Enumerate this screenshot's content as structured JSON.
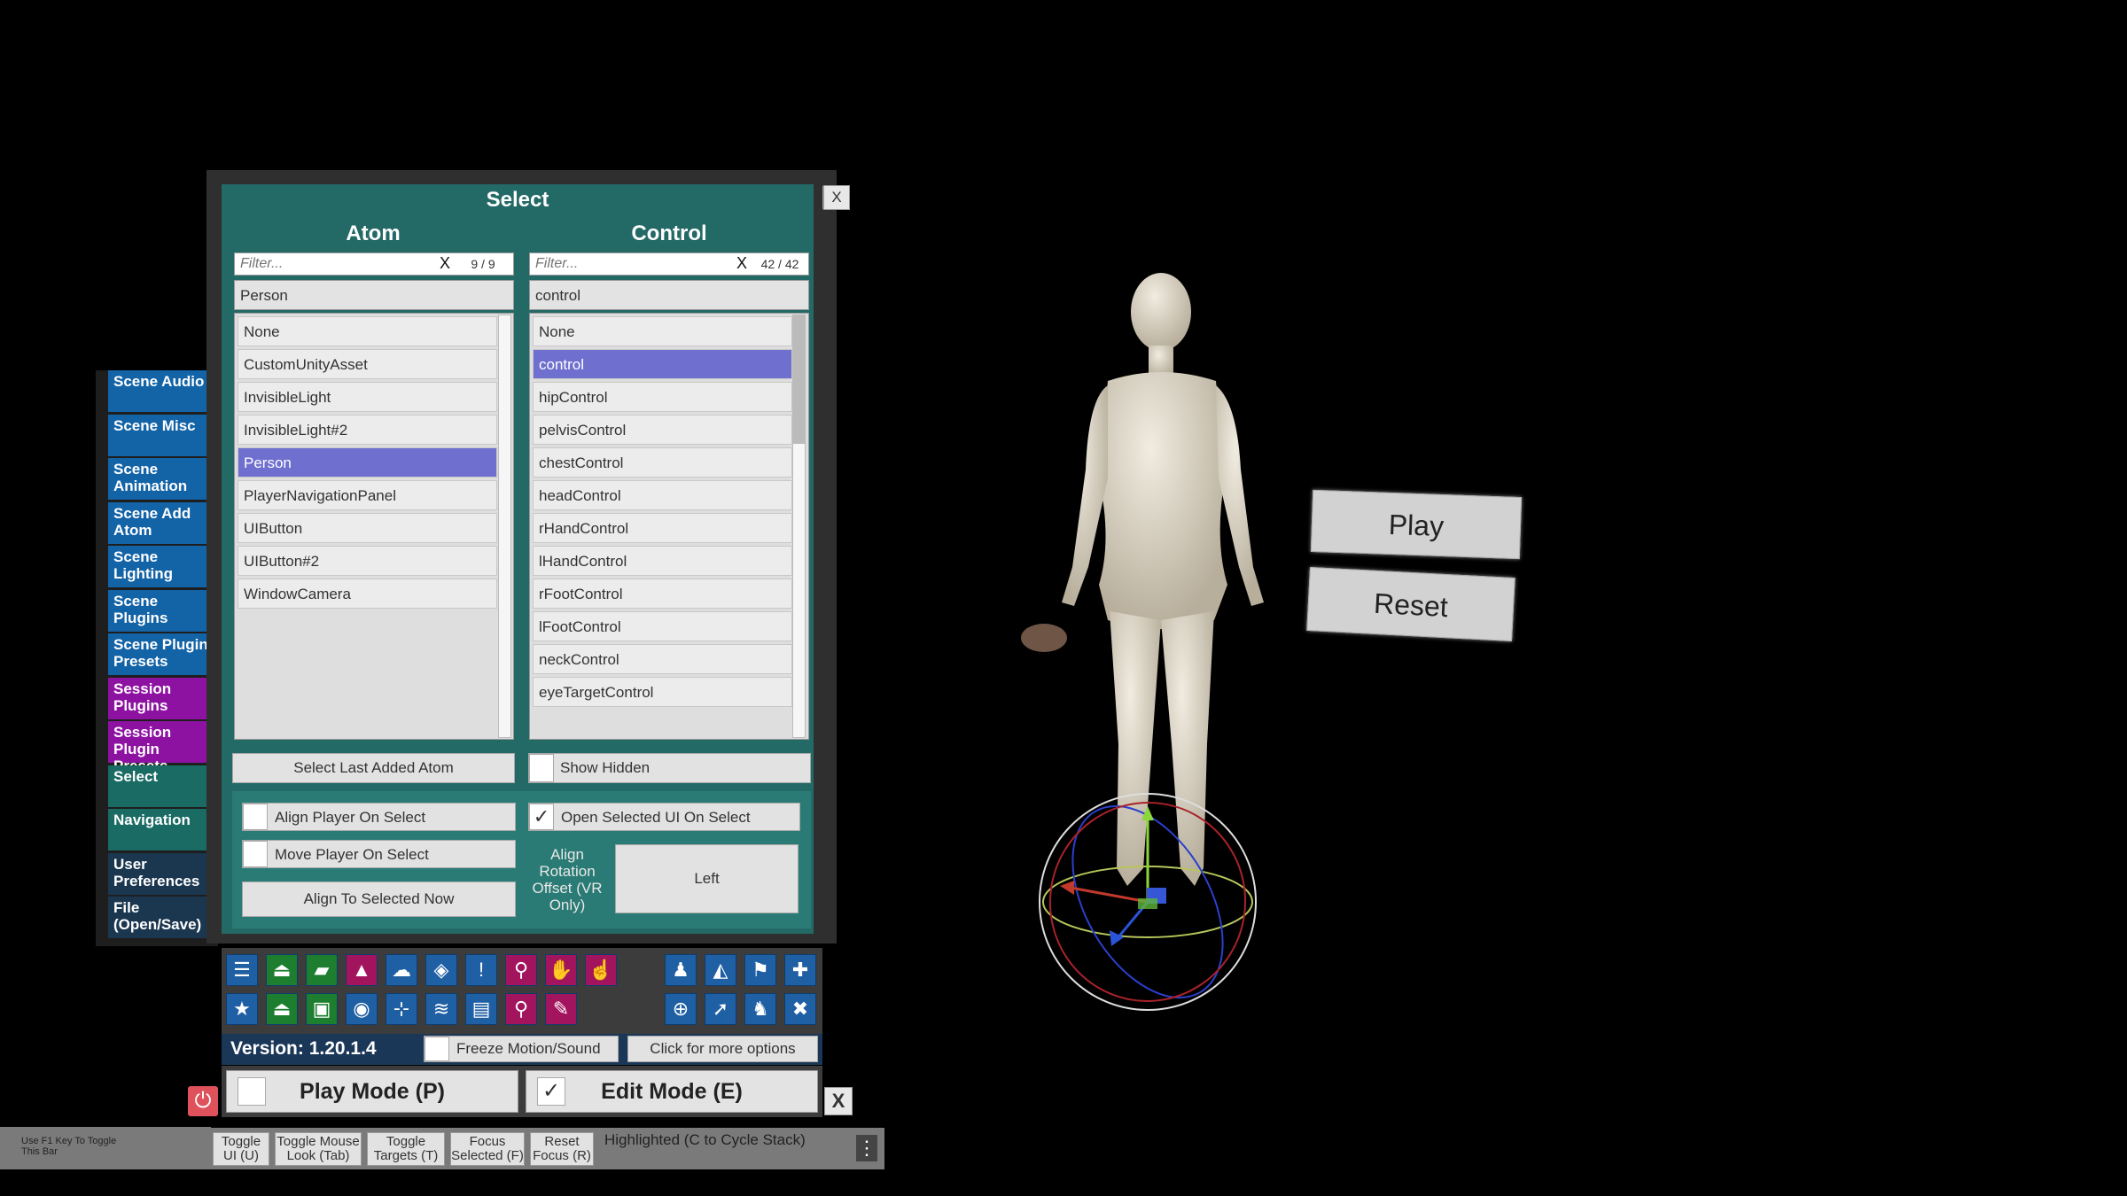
{
  "panel": {
    "title": "Select",
    "close_label": "X",
    "atom": {
      "heading": "Atom",
      "filter_placeholder": "Filter...",
      "filter_clear": "X",
      "filter_count": "9 / 9",
      "selected": "Person",
      "items": [
        "None",
        "CustomUnityAsset",
        "InvisibleLight",
        "InvisibleLight#2",
        "Person",
        "PlayerNavigationPanel",
        "UIButton",
        "UIButton#2",
        "WindowCamera"
      ],
      "selected_index": 4
    },
    "control": {
      "heading": "Control",
      "filter_placeholder": "Filter...",
      "filter_clear": "X",
      "filter_count": "42 / 42",
      "selected": "control",
      "items": [
        "None",
        "control",
        "hipControl",
        "pelvisControl",
        "chestControl",
        "headControl",
        "rHandControl",
        "lHandControl",
        "rFootControl",
        "lFootControl",
        "neckControl",
        "eyeTargetControl"
      ],
      "selected_index": 1
    },
    "select_last_added": "Select Last Added Atom",
    "show_hidden": "Show Hidden",
    "align_player_on_select": "Align Player On Select",
    "open_selected_ui": "Open Selected UI On Select",
    "move_player_on_select": "Move Player On Select",
    "align_to_selected_now": "Align To Selected Now",
    "align_rotation_offset": "Align Rotation Offset (VR Only)",
    "align_rotation_value": "Left"
  },
  "tabs": [
    {
      "label": "Scene Audio",
      "color": "#1363a7"
    },
    {
      "label": "Scene Misc",
      "color": "#1363a7"
    },
    {
      "label": "Scene Animation",
      "color": "#1363a7"
    },
    {
      "label": "Scene Add Atom",
      "color": "#1363a7"
    },
    {
      "label": "Scene Lighting",
      "color": "#1363a7"
    },
    {
      "label": "Scene Plugins",
      "color": "#1363a7"
    },
    {
      "label": "Scene Plugin Presets",
      "color": "#1363a7"
    },
    {
      "label": "Session Plugins",
      "color": "#8e12a2"
    },
    {
      "label": "Session Plugin Presets",
      "color": "#8e12a2"
    },
    {
      "label": "Select",
      "color": "#196b63"
    },
    {
      "label": "Navigation",
      "color": "#196b63"
    },
    {
      "label": "User Preferences",
      "color": "#1b3750"
    },
    {
      "label": "File (Open/Save)",
      "color": "#1b3750"
    }
  ],
  "toolbar": {
    "row1_left": [
      "menu-icon",
      "scene-open-icon",
      "folder-icon",
      "delete-scene-icon",
      "cloud-icon",
      "package-icon",
      "alert-icon",
      "person-add-icon",
      "hand-icon",
      "touch-icon"
    ],
    "row1_left_glyphs": [
      "☰",
      "⏏",
      "▰",
      "▲",
      "☁",
      "◈",
      "!",
      "⚲",
      "✋",
      "☝"
    ],
    "row2_left": [
      "star-icon",
      "scene-load-icon",
      "screenshot-folder-icon",
      "camera-icon",
      "graph-icon",
      "layers-icon",
      "document-icon",
      "person-remove-icon",
      "wrench-icon"
    ],
    "row2_left_glyphs": [
      "★",
      "⏏",
      "▣",
      "◉",
      "⊹",
      "≋",
      "▤",
      "⚲",
      "✎"
    ],
    "row1_right": [
      "person-icon",
      "unity-icon",
      "flag-icon",
      "plus-icon"
    ],
    "row1_right_glyphs": [
      "♟",
      "◭",
      "⚑",
      "✚"
    ],
    "row2_right": [
      "target-icon",
      "pointer-icon",
      "people-icon",
      "tools-icon"
    ],
    "row2_right_glyphs": [
      "⊕",
      "➚",
      "♞",
      "✖"
    ]
  },
  "version_text": "Version: 1.20.1.4",
  "freeze_label": "Freeze Motion/Sound",
  "more_options_label": "Click for more options",
  "play_mode_label": "Play Mode (P)",
  "edit_mode_label": "Edit Mode (E)",
  "close_x": "X",
  "bottom_bar": {
    "hint": "Use F1 Key To Toggle This Bar",
    "buttons": [
      "Toggle UI (U)",
      "Toggle Mouse Look (Tab)",
      "Toggle Targets (T)",
      "Focus Selected (F)",
      "Reset Focus (R)"
    ],
    "highlighted": "Highlighted (C to Cycle Stack)"
  },
  "scene": {
    "play_button": "Play",
    "reset_button": "Reset"
  }
}
